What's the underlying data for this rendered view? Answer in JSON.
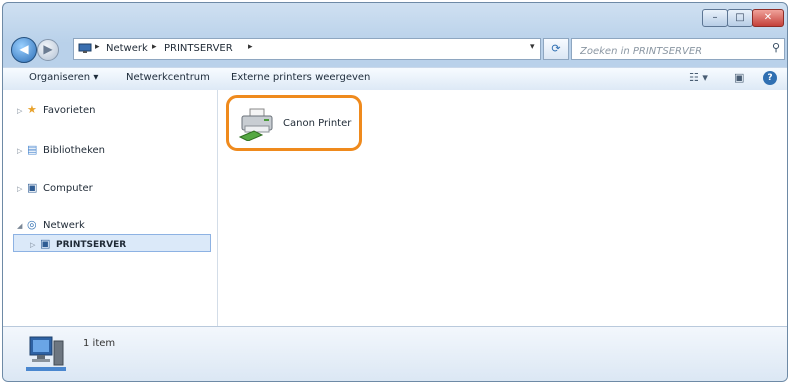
{
  "window": {
    "controls": {
      "minimize": "–",
      "maximize": "□",
      "close": "✕"
    }
  },
  "nav": {
    "back_glyph": "◀",
    "forward_glyph": "▶"
  },
  "address": {
    "crumbs": [
      "Netwerk",
      "PRINTSERVER"
    ],
    "separator": "▸",
    "dropdown_glyph": "▾",
    "refresh_glyph": "⟳"
  },
  "search": {
    "placeholder": "Zoeken in PRINTSERVER",
    "icon": "magnifier-icon"
  },
  "toolbar": {
    "organize": "Organiseren ▾",
    "network_center": "Netwerkcentrum",
    "show_printers": "Externe printers weergeven",
    "view_glyph": "☷ ▾",
    "preview_glyph": "▣",
    "help_glyph": "?"
  },
  "nav_tree": {
    "favorites": "Favorieten",
    "libraries": "Bibliotheken",
    "computer": "Computer",
    "network": "Netwerk",
    "printserver": "PRINTSERVER"
  },
  "content": {
    "items": [
      {
        "label": "Canon Printer",
        "icon": "printer-icon"
      }
    ]
  },
  "status": {
    "item_count": "1 item"
  },
  "colors": {
    "highlight": "#ef8a1d",
    "selection": "#dbe9f9"
  }
}
